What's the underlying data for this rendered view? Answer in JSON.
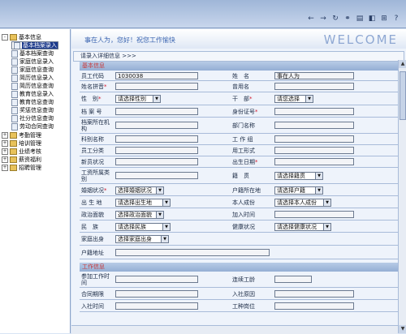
{
  "toolbar": {
    "icons": [
      "back-arrow-icon",
      "forward-arrow-icon",
      "refresh-icon",
      "link-icon",
      "print-icon",
      "save-icon",
      "cart-icon",
      "help-icon"
    ]
  },
  "tree": {
    "root": "基本信息",
    "children": [
      "基本档案录入",
      "基本档案查询",
      "家庭信息录入",
      "家庭信息查询",
      "简历信息录入",
      "简历信息查询",
      "教育信息录入",
      "教育信息查询",
      "奖惩信息查询",
      "社分信息查询",
      "劳动合同查询"
    ],
    "others": [
      "考勤管理",
      "培训管理",
      "业绩考核",
      "薪资福利",
      "招聘管理"
    ]
  },
  "welcome": {
    "message": "事在人为，您好！祝您工作愉快",
    "logo": "WELCOME"
  },
  "breadcrumb": "请录入详细信息 >>>",
  "sections": {
    "basic": "基本信息",
    "work": "工作信息"
  },
  "form": {
    "emp_code_label": "员工代码",
    "emp_code_value": "1030038",
    "name_label": "姓　名",
    "name_value": "事在人为",
    "pinyin_label": "姓名拼音",
    "former_name_label": "曾用名",
    "gender_label": "性　别",
    "gender_select": "请选择性别",
    "cadre_label": "干　部",
    "cadre_select": "请您选择",
    "archive_label": "档 案 号",
    "id_label": "身份证号",
    "archive_org_label": "档案所在机构",
    "dept_label": "部门名称",
    "office_label": "科别名称",
    "workgroup_label": "工 作 组",
    "category_label": "员工分类",
    "employ_form_label": "用工形式",
    "new_status_label": "新员状况",
    "birth_label": "出生日期",
    "wage_label": "工资所属类别",
    "origin_label": "籍　贯",
    "origin_select": "请选择籍贯",
    "marriage_label": "婚姻状况",
    "marriage_select": "选择婚姻状况",
    "hukou_place_label": "户籍所在地",
    "hukou_select": "请选择户籍",
    "birthplace_label": "出 生 地",
    "birthplace_select": "请选择出生地",
    "personal_label": "本人成份",
    "personal_select": "请选择本人成份",
    "political_label": "政治面貌",
    "political_select": "选择政治面貌",
    "join_time_label": "加入时间",
    "nation_label": "民　族",
    "nation_select": "请选择民族",
    "health_label": "健康状况",
    "health_select": "请选择健康状况",
    "family_label": "家庭出身",
    "family_select": "选择家庭出身",
    "hukou_addr_label": "户籍地址",
    "work_start_label": "参加工作时间",
    "seniority_label": "连续工龄",
    "contract_label": "合同期限",
    "entry_reason_label": "入社原因",
    "entry_time_label": "入社时间",
    "post_label": "工种岗位"
  }
}
